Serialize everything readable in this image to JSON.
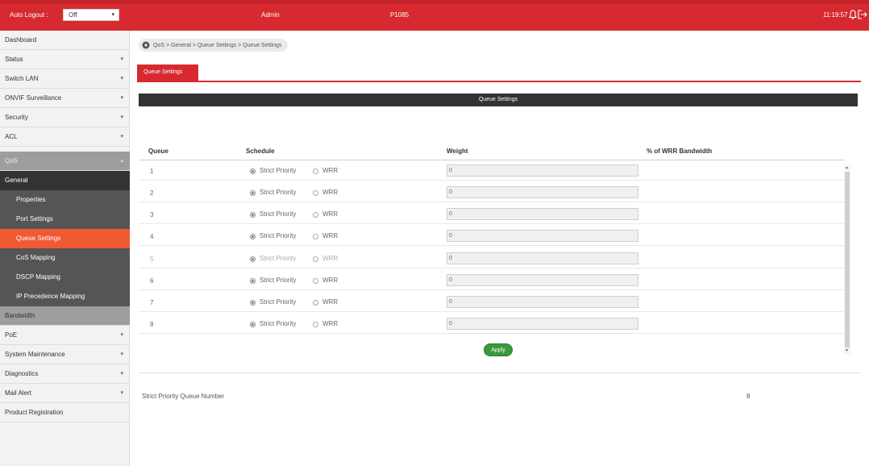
{
  "topbar": {
    "auto_logout_label": "Auto Logout :",
    "auto_logout_value": "Off",
    "user": "Admin",
    "model": "P1085",
    "time": "11:19:57"
  },
  "sidebar": {
    "items": [
      {
        "label": "Dashboard"
      },
      {
        "label": "Status"
      },
      {
        "label": "Switch LAN"
      },
      {
        "label": "ONVIF Surveillance"
      },
      {
        "label": "Security"
      },
      {
        "label": "ACL"
      },
      {
        "label": "QoS"
      },
      {
        "label": "General"
      },
      {
        "label": "Properties"
      },
      {
        "label": "Port Settings"
      },
      {
        "label": "Queue Settings"
      },
      {
        "label": "CoS Mapping"
      },
      {
        "label": "DSCP Mapping"
      },
      {
        "label": "IP Precedence Mapping"
      },
      {
        "label": "Bandwidth"
      },
      {
        "label": "PoE"
      },
      {
        "label": "System Maintenance"
      },
      {
        "label": "Diagnostics"
      },
      {
        "label": "Mail Alert"
      },
      {
        "label": "Product Registration"
      }
    ]
  },
  "breadcrumb": "QoS > General > Queue Settings > Queue Settings",
  "tab": "Queue Settings",
  "section_title": "Queue Settings",
  "table": {
    "headers": [
      "Queue",
      "Schedule",
      "Weight",
      "% of WRR Bandwidth"
    ],
    "radio_labels": {
      "strict": "Strict Priority",
      "wrr": "WRR"
    },
    "rows": [
      {
        "queue": "1",
        "weight": "0"
      },
      {
        "queue": "2",
        "weight": "0"
      },
      {
        "queue": "3",
        "weight": "0"
      },
      {
        "queue": "4",
        "weight": "0"
      },
      {
        "queue": "5",
        "weight": "0"
      },
      {
        "queue": "6",
        "weight": "0"
      },
      {
        "queue": "7",
        "weight": "0"
      },
      {
        "queue": "8",
        "weight": "0"
      }
    ]
  },
  "apply_label": "Apply",
  "strict_priority_queue_number": {
    "label": "Strict Priority Queue Number",
    "value": "8"
  },
  "colors": {
    "brand_red": "#d62a30",
    "active_orange": "#ef5a33",
    "apply_green": "#3a9a3a"
  }
}
